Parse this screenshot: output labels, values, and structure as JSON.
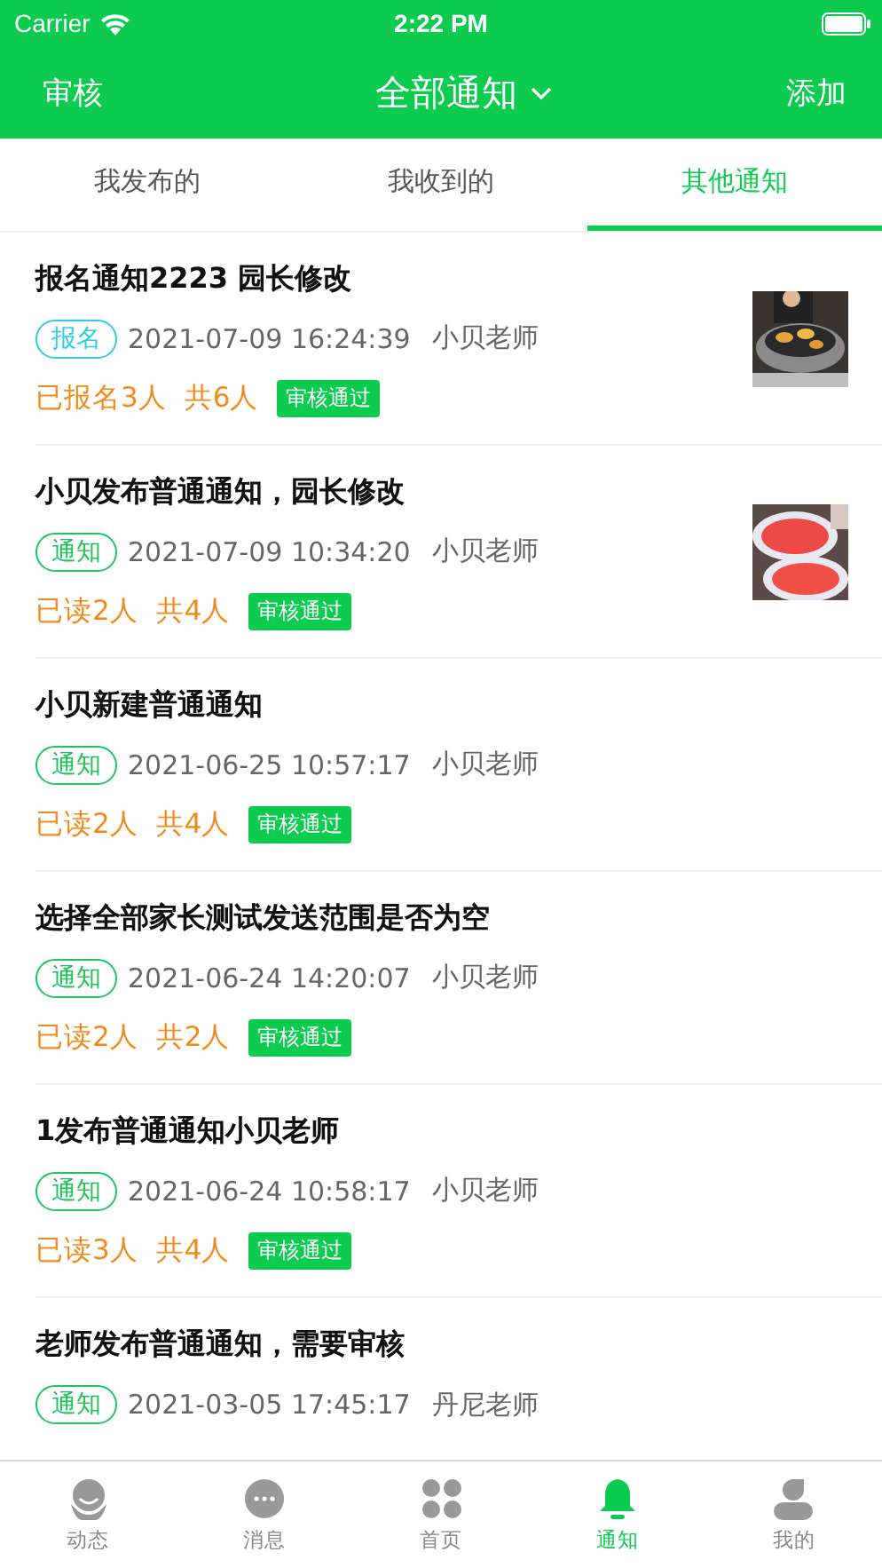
{
  "status_bar": {
    "carrier": "Carrier",
    "time": "2:22 PM"
  },
  "header": {
    "left": "审核",
    "title": "全部通知",
    "right": "添加"
  },
  "tabs": [
    {
      "label": "我发布的",
      "selected": false
    },
    {
      "label": "我收到的",
      "selected": false
    },
    {
      "label": "其他通知",
      "selected": true
    }
  ],
  "notices": [
    {
      "title": "报名通知2223  园长修改",
      "tag": "报名",
      "kind": "signup",
      "time": "2021-07-09 16:24:39",
      "author": "小贝老师",
      "count": "已报名3人",
      "total": "共6人",
      "status": "审核通过"
    },
    {
      "title": "小贝发布普通通知，园长修改",
      "tag": "通知",
      "kind": "notice",
      "time": "2021-07-09 10:34:20",
      "author": "小贝老师",
      "count": "已读2人",
      "total": "共4人",
      "status": "审核通过"
    },
    {
      "title": "小贝新建普通通知",
      "tag": "通知",
      "kind": "notice",
      "time": "2021-06-25 10:57:17",
      "author": "小贝老师",
      "count": "已读2人",
      "total": "共4人",
      "status": "审核通过"
    },
    {
      "title": "选择全部家长测试发送范围是否为空",
      "tag": "通知",
      "kind": "notice",
      "time": "2021-06-24 14:20:07",
      "author": "小贝老师",
      "count": "已读2人",
      "total": "共2人",
      "status": "审核通过"
    },
    {
      "title": "1发布普通通知小贝老师",
      "tag": "通知",
      "kind": "notice",
      "time": "2021-06-24 10:58:17",
      "author": "小贝老师",
      "count": "已读3人",
      "total": "共4人",
      "status": "审核通过"
    },
    {
      "title": "老师发布普通通知，需要审核",
      "tag": "通知",
      "kind": "notice",
      "time": "2021-03-05 17:45:17",
      "author": "丹尼老师"
    }
  ],
  "tab_bar": [
    {
      "label": "动态",
      "selected": false
    },
    {
      "label": "消息",
      "selected": false
    },
    {
      "label": "首页",
      "selected": false
    },
    {
      "label": "通知",
      "selected": true
    },
    {
      "label": "我的",
      "selected": false
    }
  ]
}
